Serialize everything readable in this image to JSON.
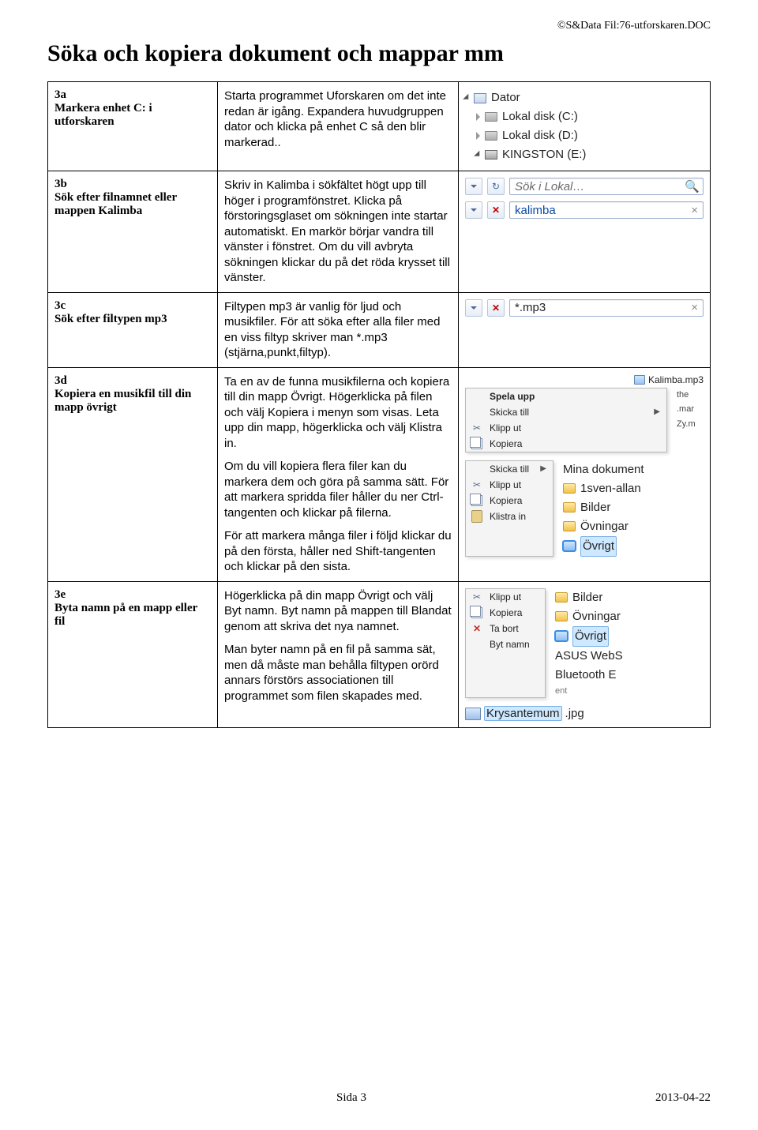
{
  "header_right": "©S&Data Fil:76-utforskaren.DOC",
  "page_title": "Söka och kopiera dokument och mappar mm",
  "rows": {
    "r3a": {
      "id": "3a",
      "title": "Markera enhet C: i utforskaren",
      "desc1": "Starta programmet Uforskaren om det inte redan är igång. Expandera huvudgruppen dator och klicka på enhet C så den blir markerad.."
    },
    "r3b": {
      "id": "3b",
      "title": "Sök efter filnamnet eller mappen Kalimba",
      "desc1": "Skriv in Kalimba i sökfältet högt upp till höger i programfönstret. Klicka på förstoringsglaset om sökningen inte startar automatiskt. En markör börjar vandra till vänster i fönstret. Om du vill avbryta sökningen klickar du på det röda krysset till vänster."
    },
    "r3c": {
      "id": "3c",
      "title": "Sök efter filtypen mp3",
      "desc1": "Filtypen mp3 är vanlig för ljud och musikfiler. För att söka efter alla filer med en viss filtyp skriver man *.mp3 (stjärna,punkt,filtyp)."
    },
    "r3d": {
      "id": "3d",
      "title": "Kopiera en musikfil till din mapp övrigt",
      "desc1": "Ta en av de funna musikfilerna och kopiera till din mapp Övrigt. Högerklicka på filen och välj Kopiera i menyn som visas. Leta upp din mapp, högerklicka och välj Klistra in.",
      "desc2": "Om du vill kopiera flera filer kan du markera dem och göra på samma sätt. För att markera spridda filer håller du ner Ctrl-tangenten och klickar på filerna.",
      "desc3": "För att markera många filer i följd klickar du på den första, håller ned Shift-tangenten och klickar på den sista."
    },
    "r3e": {
      "id": "3e",
      "title": "Byta namn på en mapp eller fil",
      "desc1": "Högerklicka på din mapp Övrigt och välj Byt namn. Byt namn på mappen till Blandat genom att skriva det nya namnet.",
      "desc2": "Man byter namn på en fil på samma sät, men då måste man behålla filtypen orörd annars förstörs associationen till programmet som filen skapades med."
    }
  },
  "shots": {
    "tree": {
      "root": "Dator",
      "items": [
        "Lokal disk (C:)",
        "Lokal disk (D:)",
        "KINGSTON (E:)"
      ]
    },
    "search1": {
      "placeholder": "Sök i Lokal…",
      "input": "kalimba"
    },
    "search2": {
      "input": "*.mp3"
    },
    "ctx1": {
      "file": "Kalimba.mp3",
      "items": [
        "Spela upp",
        "Skicka till",
        "Klipp ut",
        "Kopiera"
      ],
      "right": [
        "the",
        ".mar",
        "Zy.m"
      ]
    },
    "ctx2": {
      "left": [
        "Skicka till",
        "Klipp ut",
        "Kopiera",
        "Klistra in"
      ],
      "right": [
        "Mina dokument",
        "1sven-allan",
        "Bilder",
        "Övningar",
        "Övrigt"
      ]
    },
    "ctx3": {
      "left": [
        "Klipp ut",
        "Kopiera",
        "Ta bort",
        "Byt namn"
      ],
      "right": [
        "Bilder",
        "Övningar",
        "Övrigt",
        "ASUS WebS",
        "Bluetooth E"
      ],
      "ent": "ent"
    },
    "rename": {
      "name": "Krysantemum",
      "ext": ".jpg"
    }
  },
  "footer": {
    "page": "Sida 3",
    "date": "2013-04-22"
  }
}
